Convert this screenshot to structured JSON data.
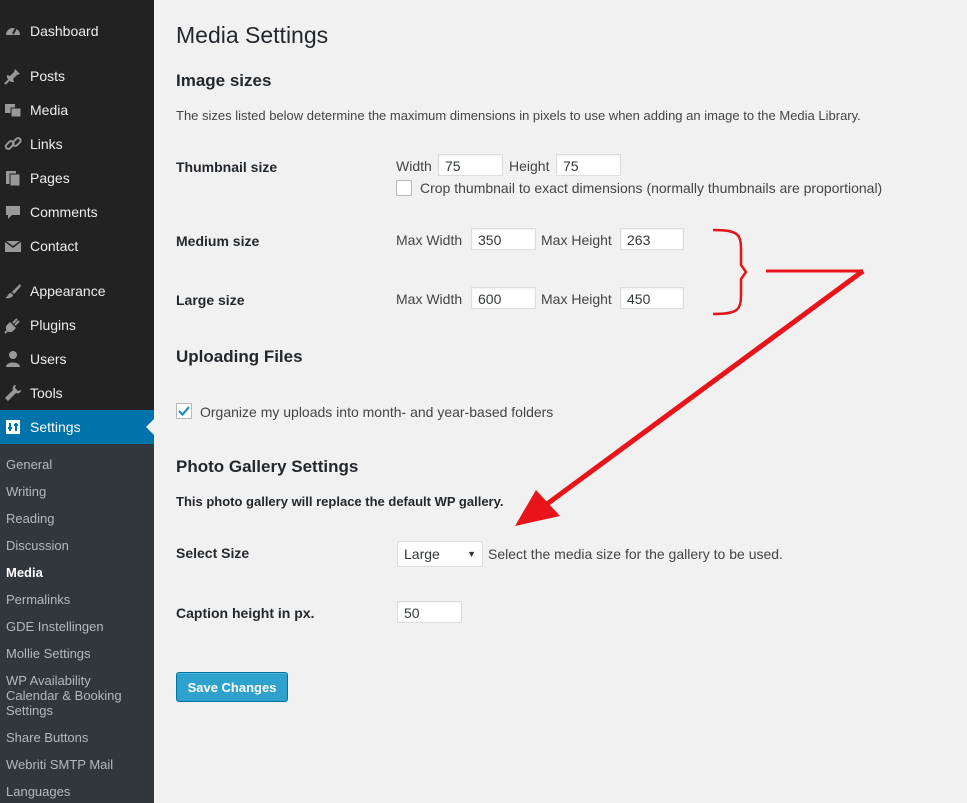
{
  "sidebar": {
    "items": [
      {
        "label": "Dashboard",
        "icon": "dashboard-icon"
      },
      {
        "label": "Posts",
        "icon": "pin-icon"
      },
      {
        "label": "Media",
        "icon": "media-icon"
      },
      {
        "label": "Links",
        "icon": "link-icon"
      },
      {
        "label": "Pages",
        "icon": "pages-icon"
      },
      {
        "label": "Comments",
        "icon": "comment-icon"
      },
      {
        "label": "Contact",
        "icon": "envelope-icon"
      },
      {
        "label": "Appearance",
        "icon": "brush-icon"
      },
      {
        "label": "Plugins",
        "icon": "plug-icon"
      },
      {
        "label": "Users",
        "icon": "user-icon"
      },
      {
        "label": "Tools",
        "icon": "wrench-icon"
      },
      {
        "label": "Settings",
        "icon": "settings-icon"
      }
    ],
    "submenu": [
      "General",
      "Writing",
      "Reading",
      "Discussion",
      "Media",
      "Permalinks",
      "GDE Instellingen",
      "Mollie Settings",
      "WP Availability Calendar & Booking Settings",
      "Share Buttons",
      "Webriti SMTP Mail",
      "Languages"
    ]
  },
  "page": {
    "title": "Media Settings",
    "image_sizes": {
      "heading": "Image sizes",
      "description": "The sizes listed below determine the maximum dimensions in pixels to use when adding an image to the Media Library.",
      "thumbnail": {
        "label": "Thumbnail size",
        "width_label": "Width",
        "width": "75",
        "height_label": "Height",
        "height": "75",
        "crop_label": "Crop thumbnail to exact dimensions (normally thumbnails are proportional)",
        "crop_checked": false
      },
      "medium": {
        "label": "Medium size",
        "width_label": "Max Width",
        "width": "350",
        "height_label": "Max Height",
        "height": "263"
      },
      "large": {
        "label": "Large size",
        "width_label": "Max Width",
        "width": "600",
        "height_label": "Max Height",
        "height": "450"
      }
    },
    "uploading": {
      "heading": "Uploading Files",
      "organize_label": "Organize my uploads into month- and year-based folders",
      "organize_checked": true
    },
    "gallery": {
      "heading": "Photo Gallery Settings",
      "description": "This photo gallery will replace the default WP gallery.",
      "select_size_label": "Select Size",
      "select_size_value": "Large",
      "select_size_hint": "Select the media size for the gallery to be used.",
      "caption_label": "Caption height in px.",
      "caption_value": "50"
    },
    "save_label": "Save Changes"
  },
  "colors": {
    "sidebar_bg": "#222222",
    "submenu_bg": "#32373c",
    "active_bg": "#0073aa",
    "button_bg": "#2ea2cc",
    "annotation_red": "#e8141a"
  }
}
